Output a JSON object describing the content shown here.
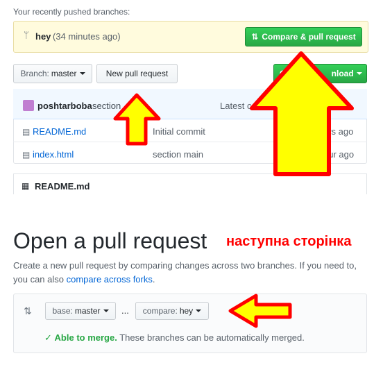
{
  "recent_branches": {
    "label": "Your recently pushed branches:",
    "branch_name": "hey",
    "pushed_time": "(34 minutes ago)",
    "compare_button": "Compare & pull request"
  },
  "toolbar": {
    "branch_prefix": "Branch:",
    "branch_value": "master",
    "new_pr_button": "New pull request",
    "clone_button_partial": "C",
    "clone_button_suffix": "nload"
  },
  "commit_header": {
    "author": "poshtarboba",
    "message": "section",
    "latest_label": "Latest co",
    "time_partial": "o"
  },
  "files": [
    {
      "name": "README.md",
      "message": "Initial commit",
      "age": "urs ago"
    },
    {
      "name": "index.html",
      "message": "section main",
      "age": "our ago"
    }
  ],
  "readme": {
    "title": "README.md"
  },
  "pr_page": {
    "title": "Open a pull request",
    "annotation": "наступна сторінка",
    "description_line1": "Create a new pull request by comparing changes across two branches. If you need to,",
    "description_prefix": "you can also ",
    "description_link": "compare across forks",
    "description_suffix": ".",
    "base_prefix": "base:",
    "base_value": "master",
    "ellipsis": "...",
    "compare_prefix": "compare:",
    "compare_value": "hey",
    "merge_status": "Able to merge.",
    "merge_detail": "These branches can be automatically merged.",
    "merge_check": "✓"
  },
  "colors": {
    "annotation_arrow_fill": "#ffff00",
    "annotation_arrow_stroke": "#ff0000",
    "primary_green": "#28a745",
    "link_blue": "#0366d6"
  }
}
